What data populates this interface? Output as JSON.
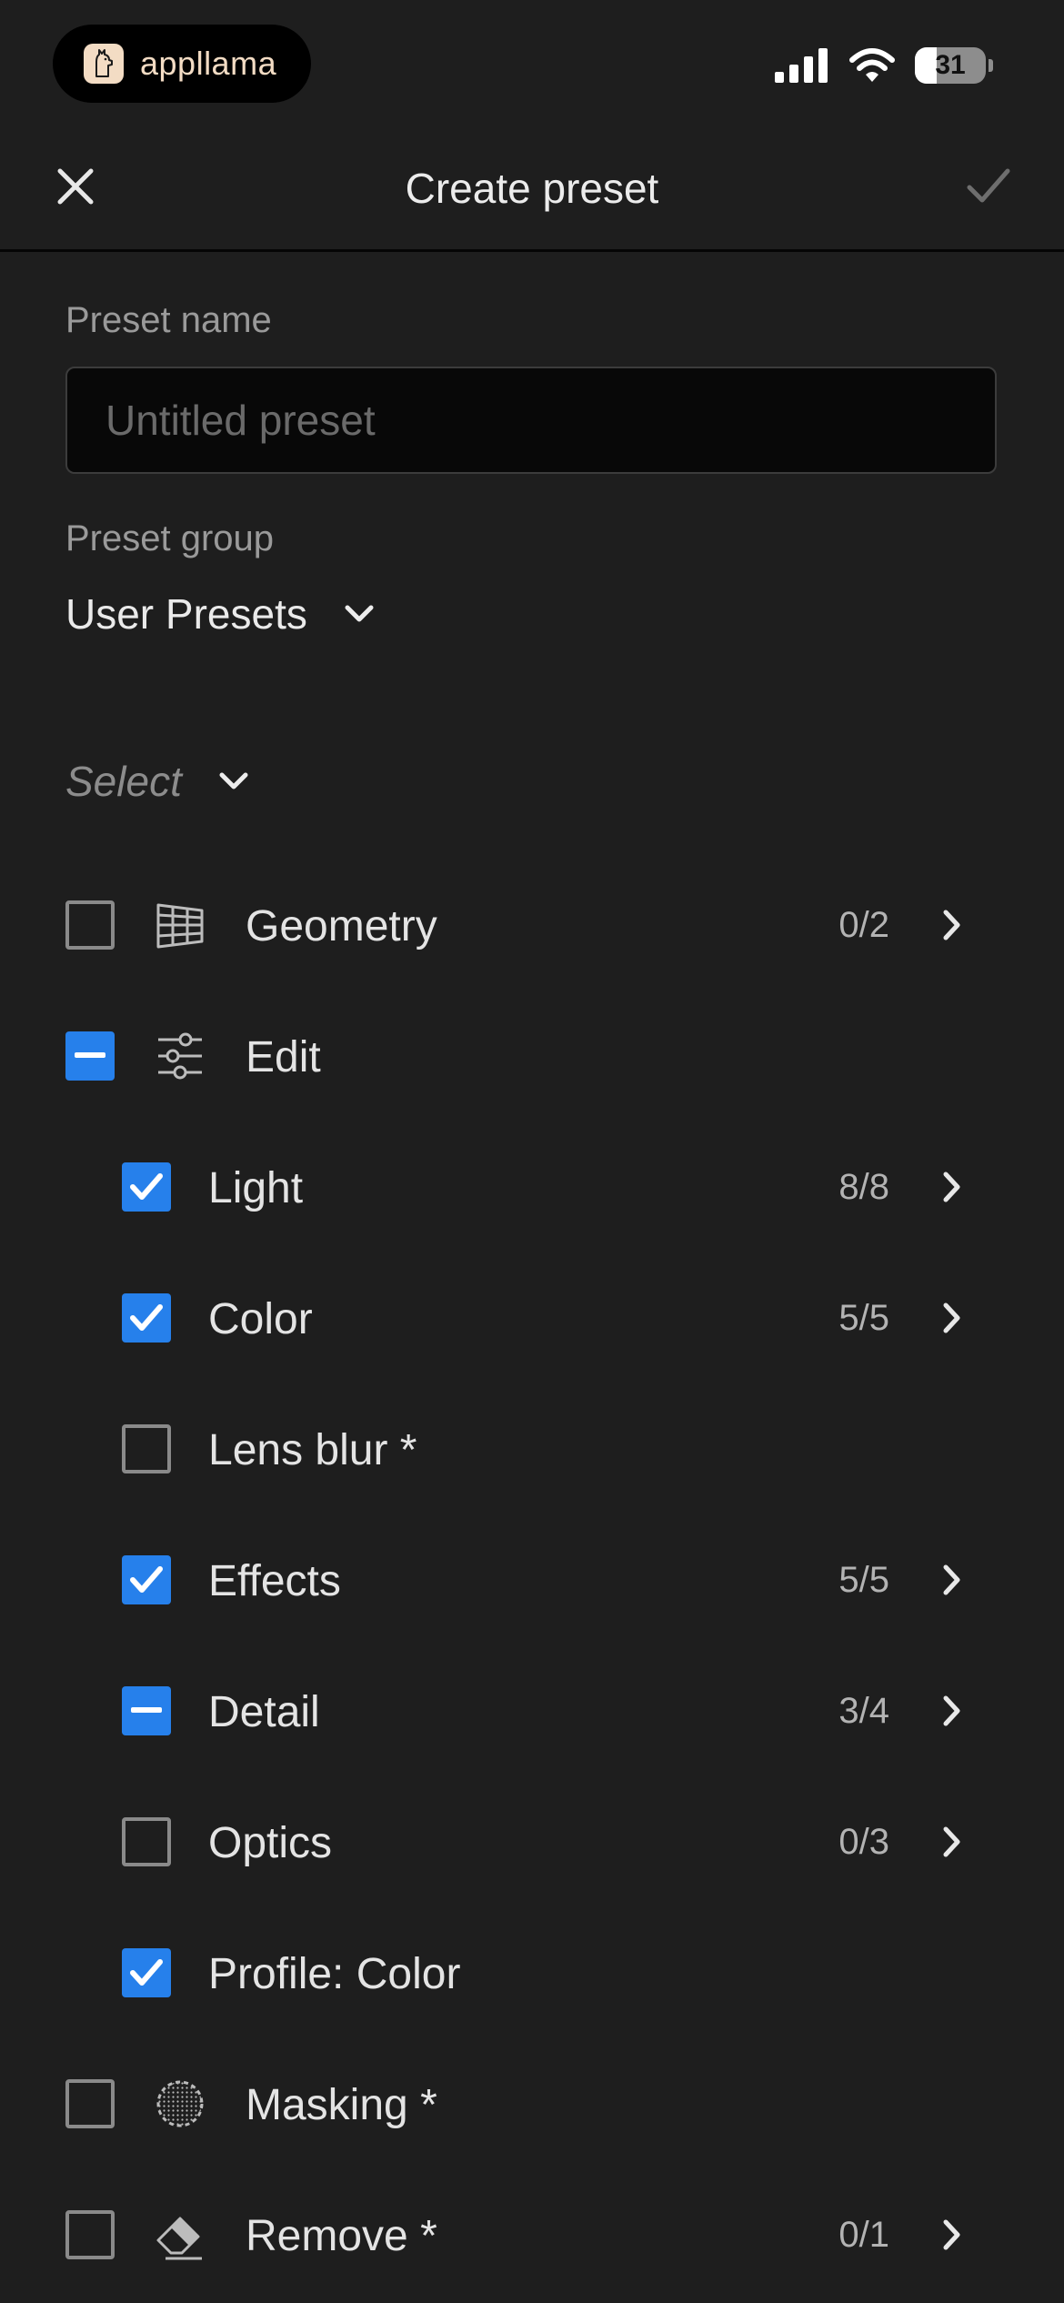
{
  "status_bar": {
    "app_name": "appllama",
    "battery": 31,
    "battery_fraction": 0.31
  },
  "header": {
    "title": "Create preset",
    "close_icon": "close-icon",
    "confirm_icon": "checkmark-icon"
  },
  "form": {
    "name_label": "Preset name",
    "name_value": "",
    "name_placeholder": "Untitled preset",
    "group_label": "Preset group",
    "group_value": "User Presets",
    "select_label": "Select"
  },
  "colors": {
    "accent": "#2680eb",
    "background": "#1e1e1e",
    "input_background": "#080808"
  },
  "rows": [
    {
      "label": "Geometry",
      "state": "unchecked",
      "icon": "geometry-grid-icon",
      "count": "0/2",
      "chevron": true,
      "level": 0
    },
    {
      "label": "Edit",
      "state": "mixed",
      "icon": "sliders-icon",
      "count": "",
      "chevron": false,
      "level": 0
    },
    {
      "label": "Light",
      "state": "checked",
      "count": "8/8",
      "chevron": true,
      "level": 1
    },
    {
      "label": "Color",
      "state": "checked",
      "count": "5/5",
      "chevron": true,
      "level": 1
    },
    {
      "label": "Lens blur *",
      "state": "unchecked",
      "count": "",
      "chevron": false,
      "level": 1
    },
    {
      "label": "Effects",
      "state": "checked",
      "count": "5/5",
      "chevron": true,
      "level": 1
    },
    {
      "label": "Detail",
      "state": "mixed",
      "count": "3/4",
      "chevron": true,
      "level": 1
    },
    {
      "label": "Optics",
      "state": "unchecked",
      "count": "0/3",
      "chevron": true,
      "level": 1
    },
    {
      "label": "Profile: Color",
      "state": "checked",
      "count": "",
      "chevron": false,
      "level": 1
    },
    {
      "label": "Masking *",
      "state": "unchecked",
      "icon": "masking-icon",
      "count": "",
      "chevron": false,
      "level": 0
    },
    {
      "label": "Remove *",
      "state": "unchecked",
      "icon": "eraser-icon",
      "count": "0/1",
      "chevron": true,
      "level": 0
    }
  ]
}
